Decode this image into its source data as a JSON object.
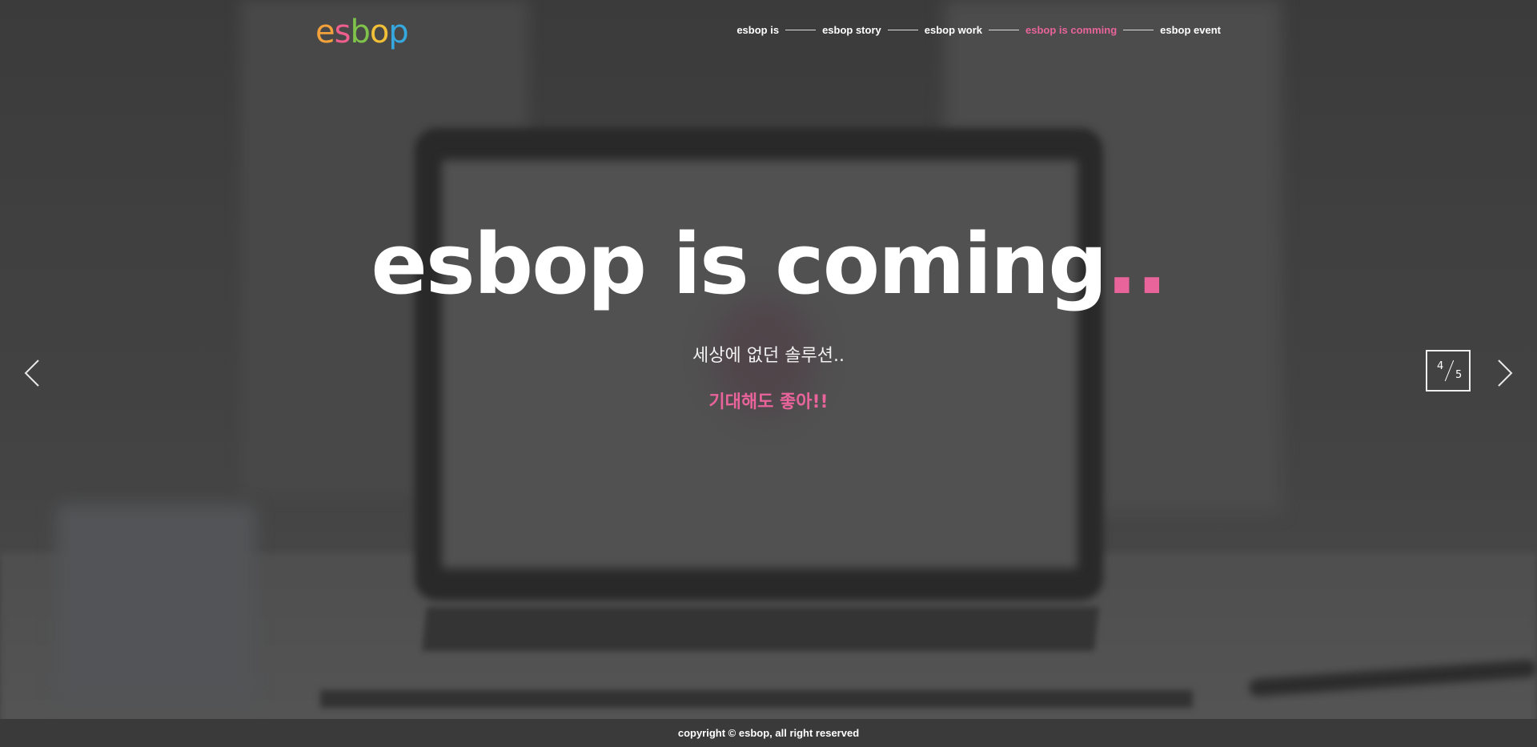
{
  "brand": {
    "logo_letters": [
      {
        "char": "e",
        "color": "#f3a13b"
      },
      {
        "char": "s",
        "color": "#ef5f8d"
      },
      {
        "char": "b",
        "color": "#7fc34a"
      },
      {
        "char": "o",
        "color": "#f2c037"
      },
      {
        "char": "p",
        "color": "#35a8e0"
      }
    ]
  },
  "nav": {
    "items": [
      {
        "label": "esbop is",
        "active": false
      },
      {
        "label": "esbop story",
        "active": false
      },
      {
        "label": "esbop work",
        "active": false
      },
      {
        "label": "esbop is comming",
        "active": true
      },
      {
        "label": "esbop event",
        "active": false
      }
    ]
  },
  "hero": {
    "title": "esbop is coming",
    "title_dots": "..",
    "subtitle": "세상에 없던 솔루션..",
    "cta": "기대해도 좋아!!"
  },
  "pager": {
    "current": "4",
    "total": "5"
  },
  "controls": {
    "prev_icon": "chevron-left-icon",
    "next_icon": "chevron-right-icon"
  },
  "footer": {
    "copyright": "copyright © esbop, all right reserved"
  },
  "colors": {
    "accent": "#e8649a",
    "footer_bg": "#3a3a3a"
  }
}
